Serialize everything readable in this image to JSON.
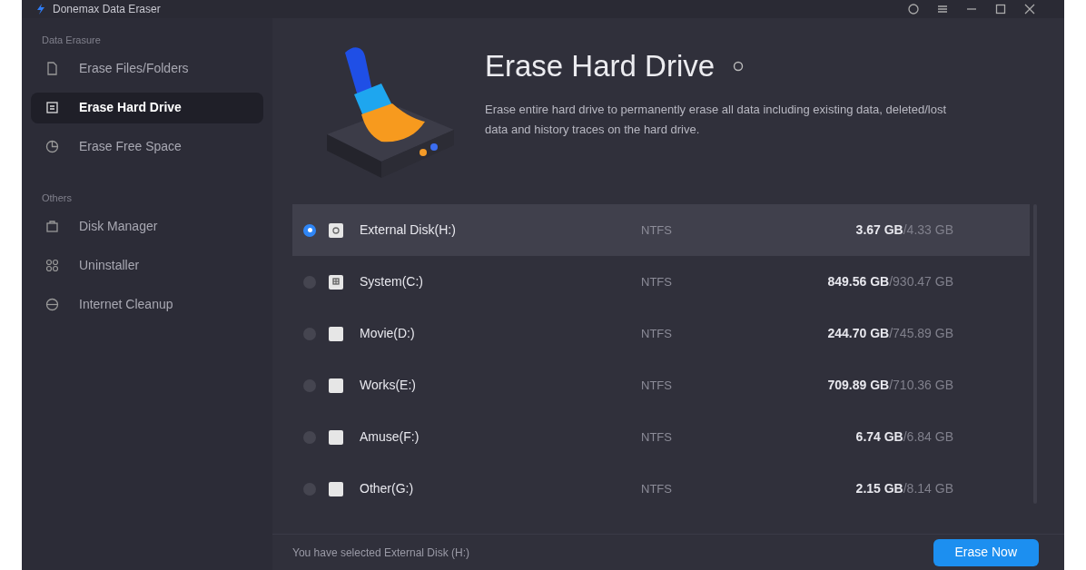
{
  "window": {
    "title": "Donemax Data Eraser"
  },
  "sidebar": {
    "sections": [
      {
        "heading": "Data Erasure",
        "items": [
          {
            "label": "Erase Files/Folders",
            "kind": "file",
            "selected": false
          },
          {
            "label": "Erase Hard Drive",
            "kind": "drive",
            "selected": true
          },
          {
            "label": "Erase Free Space",
            "kind": "pie",
            "selected": false
          }
        ]
      },
      {
        "heading": "Others",
        "items": [
          {
            "label": "Disk Manager",
            "kind": "box",
            "selected": false
          },
          {
            "label": "Uninstaller",
            "kind": "grid",
            "selected": false
          },
          {
            "label": "Internet Cleanup",
            "kind": "globe",
            "selected": false
          }
        ]
      }
    ]
  },
  "header": {
    "title": "Erase Hard Drive",
    "description": "Erase entire hard drive to permanently erase all data including existing data, deleted/lost data and history traces on the hard drive."
  },
  "disks": [
    {
      "name": "External Disk(H:)",
      "fs": "NTFS",
      "used": "3.67 GB",
      "total": "/4.33 GB",
      "selected": true,
      "kind": "usb"
    },
    {
      "name": "System(C:)",
      "fs": "NTFS",
      "used": "849.56 GB",
      "total": "/930.47 GB",
      "selected": false,
      "kind": "system"
    },
    {
      "name": "Movie(D:)",
      "fs": "NTFS",
      "used": "244.70 GB",
      "total": "/745.89 GB",
      "selected": false,
      "kind": "plain"
    },
    {
      "name": "Works(E:)",
      "fs": "NTFS",
      "used": "709.89 GB",
      "total": "/710.36 GB",
      "selected": false,
      "kind": "plain"
    },
    {
      "name": "Amuse(F:)",
      "fs": "NTFS",
      "used": "6.74 GB",
      "total": "/6.84 GB",
      "selected": false,
      "kind": "plain"
    },
    {
      "name": "Other(G:)",
      "fs": "NTFS",
      "used": "2.15 GB",
      "total": "/8.14 GB",
      "selected": false,
      "kind": "plain"
    }
  ],
  "footer": {
    "status": "You have selected External Disk (H:)",
    "button": "Erase Now"
  }
}
